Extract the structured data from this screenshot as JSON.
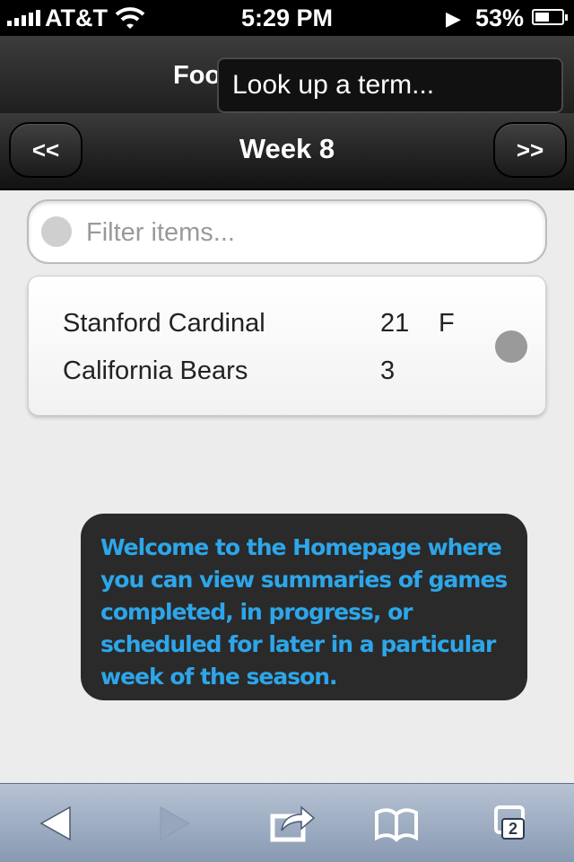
{
  "status_bar": {
    "carrier": "AT&T",
    "time": "5:29 PM",
    "battery_percent": "53%",
    "battery_level": 0.53
  },
  "header": {
    "title_fragment": "Foo"
  },
  "lookup_popover": {
    "text": "Look up a term..."
  },
  "week_nav": {
    "prev_label": "<<",
    "title": "Week 8",
    "next_label": ">>"
  },
  "filter": {
    "placeholder": "Filter items...",
    "value": ""
  },
  "games": [
    {
      "home_team": "Stanford Cardinal",
      "home_score": "21",
      "status": "F",
      "away_team": "California Bears",
      "away_score": "3"
    }
  ],
  "tooltip": {
    "text": "Welcome to the Homepage where you can view summaries of games completed, in progress, or scheduled for later in a particular week of the season."
  },
  "toolbar": {
    "tabs_count": "2"
  },
  "colors": {
    "tooltip_text": "#2da6ea",
    "toolbar": "#a3b1c5"
  }
}
